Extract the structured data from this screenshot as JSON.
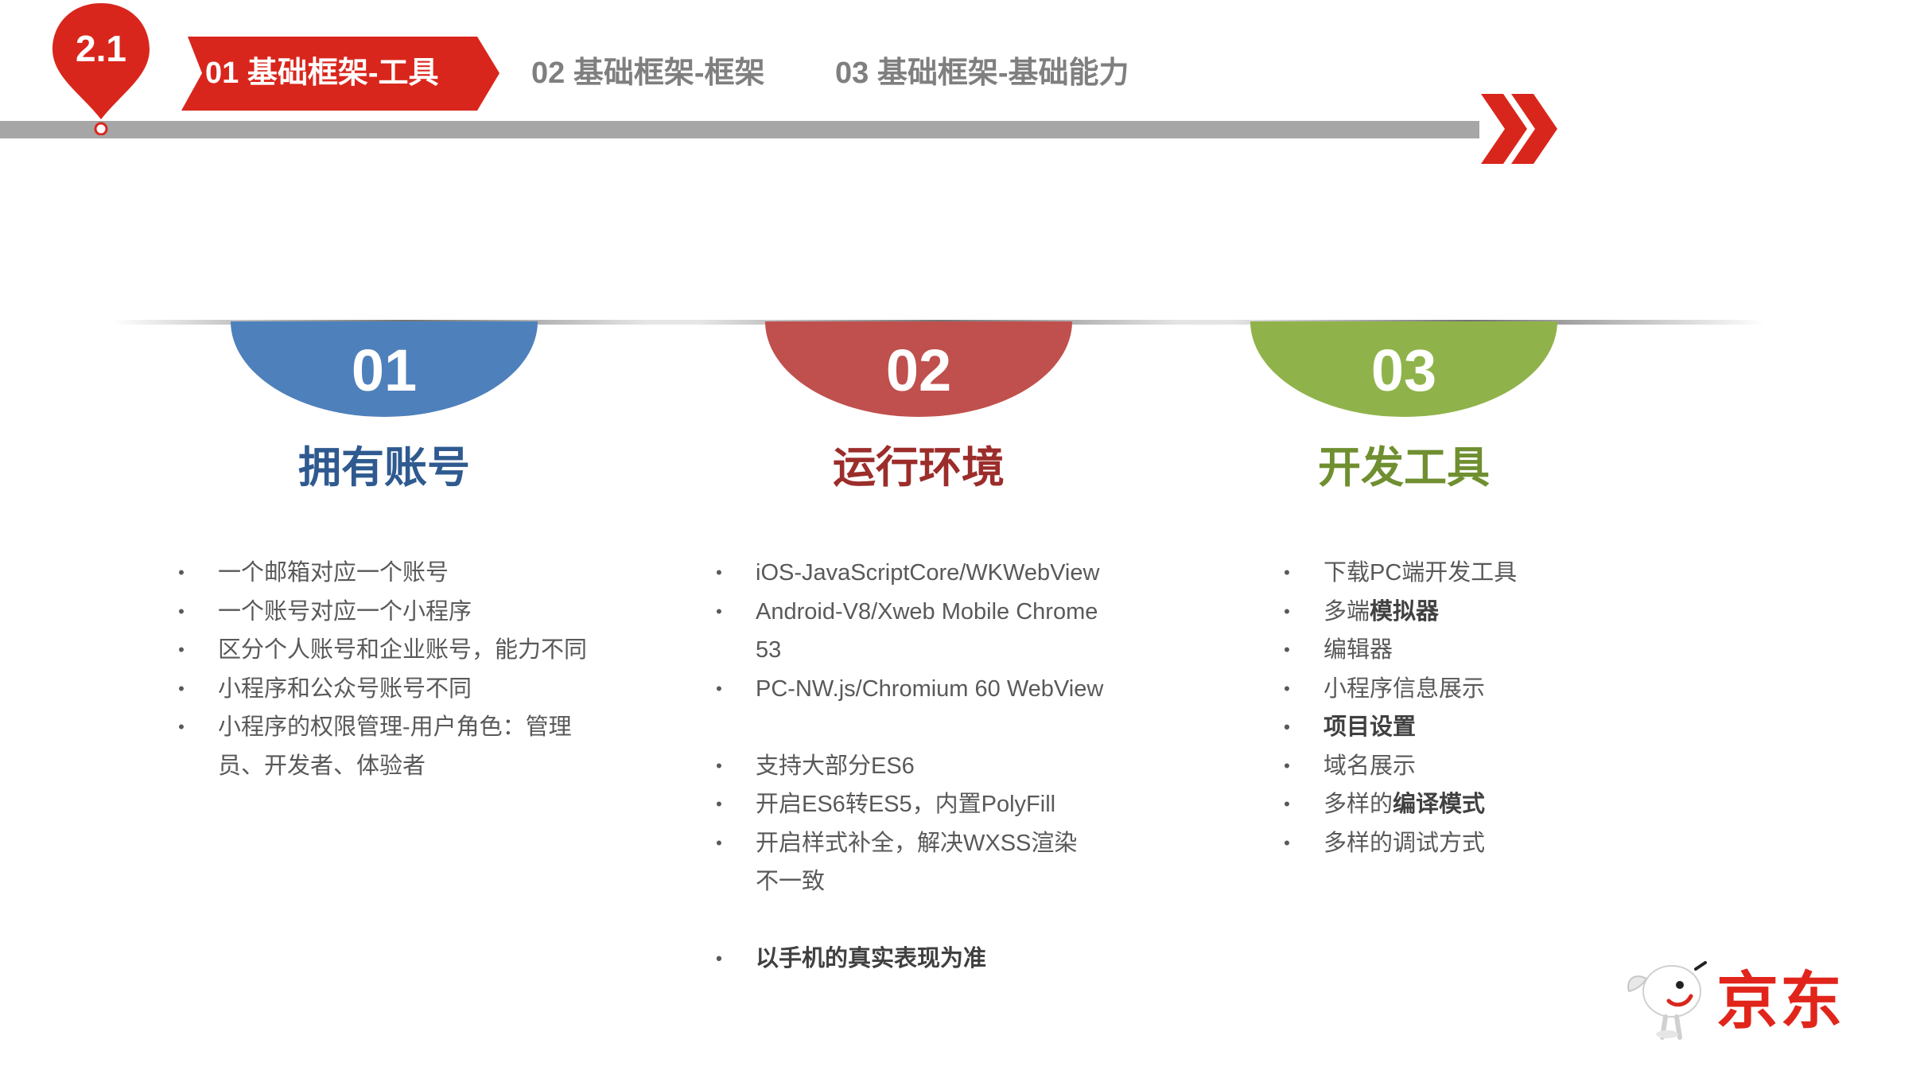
{
  "header": {
    "section_number": "2.1",
    "tabs": [
      {
        "label": "01  基础框架-工具",
        "active": true
      },
      {
        "label": "02  基础框架-框架",
        "active": false
      },
      {
        "label": "03  基础框架-基础能力",
        "active": false
      }
    ]
  },
  "columns": [
    {
      "number": "01",
      "title": "拥有账号",
      "color": "#4e80bc",
      "title_color": "#2f5a90",
      "items": [
        "一个邮箱对应一个账号",
        "一个账号对应一个小程序",
        "区分个人账号和企业账号，能力不同",
        "小程序和公众号账号不同",
        "小程序的权限管理-用户角色：管理员、开发者、体验者"
      ]
    },
    {
      "number": "02",
      "title": "运行环境",
      "color": "#c0504d",
      "title_color": "#9b2d2a",
      "items": [
        "iOS-JavaScriptCore/WKWebView",
        "Android-V8/Xweb Mobile Chrome 53",
        "PC-NW.js/Chromium 60 WebView",
        "支持大部分ES6",
        "开启ES6转ES5，内置PolyFill",
        "开启样式补全，解决WXSS渲染不一致",
        "以手机的真实表现为准"
      ]
    },
    {
      "number": "03",
      "title": "开发工具",
      "color": "#8fb34a",
      "title_color": "#6f8f30",
      "items": [
        "下载PC端开发工具",
        "多端",
        "模拟器",
        "编辑器",
        "小程序信息展示",
        "项目设置",
        "域名展示",
        "多样的",
        "编译模式",
        "多样的调试方式"
      ]
    }
  ],
  "logo": {
    "text": "京东",
    "icon": "jd-mascot-icon",
    "color": "#e1251b"
  },
  "colors": {
    "accent": "#d9261c",
    "gray": "#a6a6a6"
  }
}
